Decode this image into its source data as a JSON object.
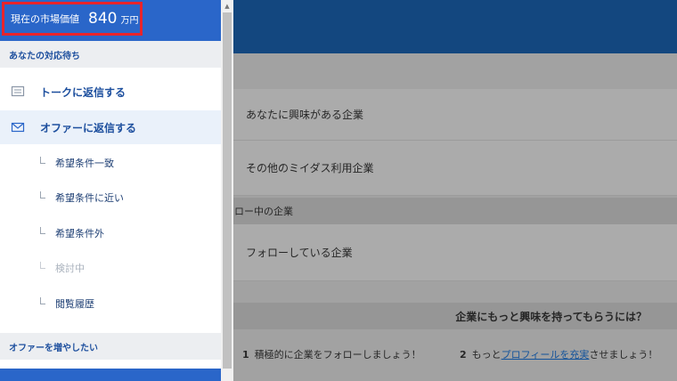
{
  "market": {
    "label": "現在の市場価値",
    "value": "840",
    "unit": "万円"
  },
  "sections": {
    "pending": "あなたの対応待ち",
    "increase": "オファーを増やしたい"
  },
  "menu": {
    "reply_talk": "トークに返信する",
    "reply_offer": "オファーに返信する",
    "sub_items": [
      {
        "label": "希望条件一致"
      },
      {
        "label": "希望条件に近い"
      },
      {
        "label": "希望条件外"
      },
      {
        "label": "検討中"
      },
      {
        "label": "閲覧履歴"
      }
    ]
  },
  "background": {
    "row1": "あなたに興味がある企業",
    "row2": "その他のミイダス利用企業",
    "band1": "ォロー中の企業",
    "row3": "フォローしている企業",
    "band2": "企業にもっと興味を持ってもらうには？",
    "tip1_num": "1",
    "tip1_text": "積極的に企業をフォローしましょう！",
    "tip2_num": "2",
    "tip2_pre": "もっと",
    "tip2_link": "プロフィールを充実",
    "tip2_post": "させましょう！"
  },
  "colors": {
    "brand": "#2a66c9",
    "highlight": "#e8242b",
    "text": "#1d4f9e"
  },
  "icons": {
    "talk": "speech-bubble-icon",
    "offer": "envelope-icon",
    "scroll_up": "triangle-up-icon"
  }
}
